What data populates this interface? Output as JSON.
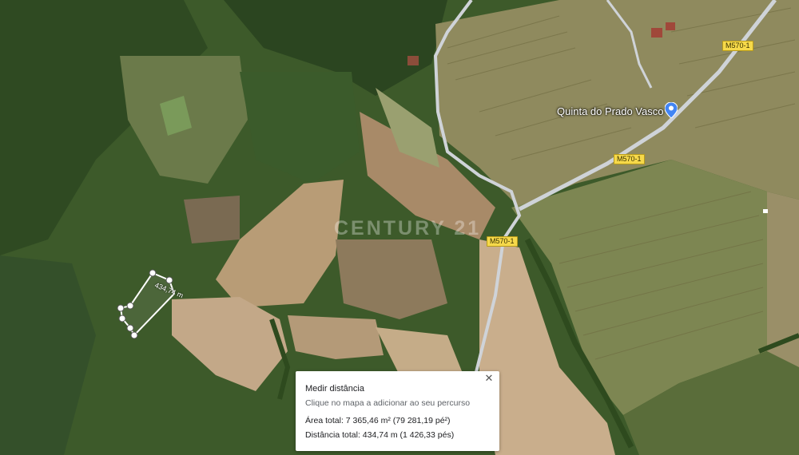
{
  "watermark": "CENTURY 21",
  "place": {
    "name": "Quinta do Prado Vasco"
  },
  "road_labels": [
    "M570-1",
    "M570-1",
    "M570-1"
  ],
  "measurement": {
    "distance_on_map": "434,74 m"
  },
  "panel": {
    "title": "Medir distância",
    "hint": "Clique no mapa a adicionar ao seu percurso",
    "area_label": "Área total:",
    "area_value": "7 365,46 m² (79 281,19 pé²)",
    "distance_label": "Distância total:",
    "distance_value": "434,74 m (1 426,33 pés)",
    "close_symbol": "✕"
  },
  "colors": {
    "road_label_bg": "#f6d94a",
    "pin": "#4285f4",
    "road": "#cfd3d8"
  }
}
